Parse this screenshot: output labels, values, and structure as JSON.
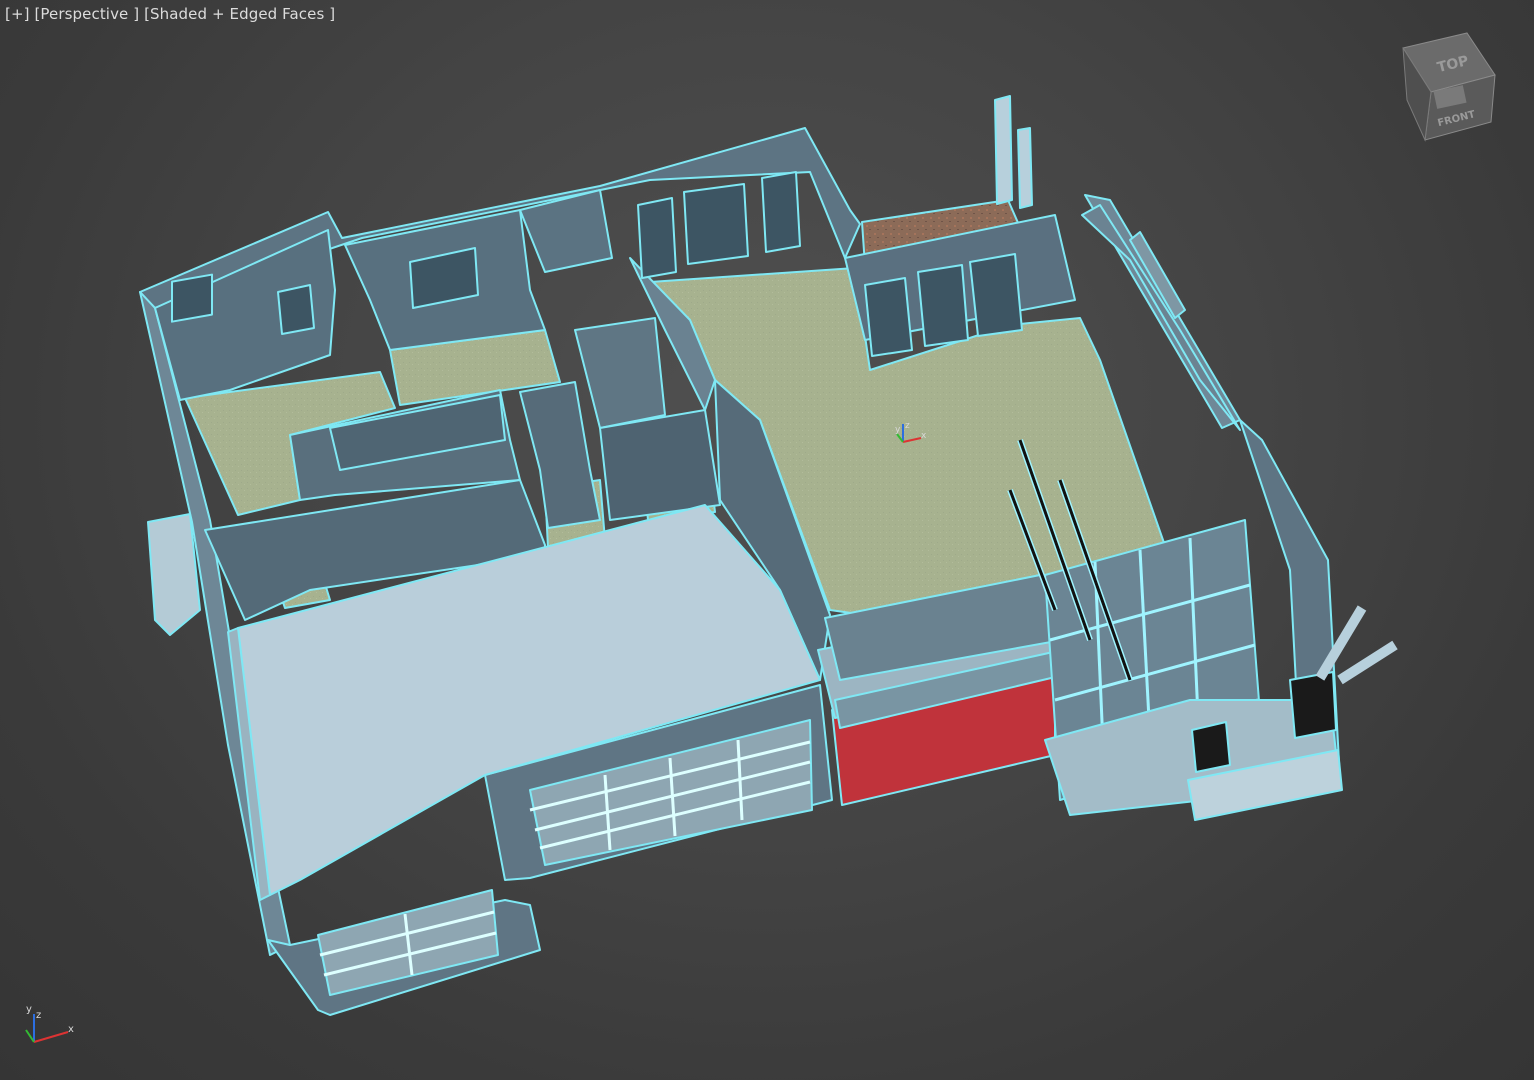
{
  "viewport": {
    "menu_plus": "[+]",
    "view_mode": "[Perspective ]",
    "shading_mode": "[Shaded + Edged Faces ]"
  },
  "viewcube": {
    "top_label": "TOP",
    "front_label": "FRONT"
  },
  "axes": {
    "x": "x",
    "y": "y",
    "z": "z"
  },
  "colors": {
    "background": "#444444",
    "selection_edge": "#7fe8f4",
    "wall": "#5b7180",
    "wall_light": "#8eaab6",
    "floor": "#a9b48f",
    "garage_roof": "#b9d0db",
    "accent_red": "#c0333b",
    "deck": "#8a6a56"
  }
}
